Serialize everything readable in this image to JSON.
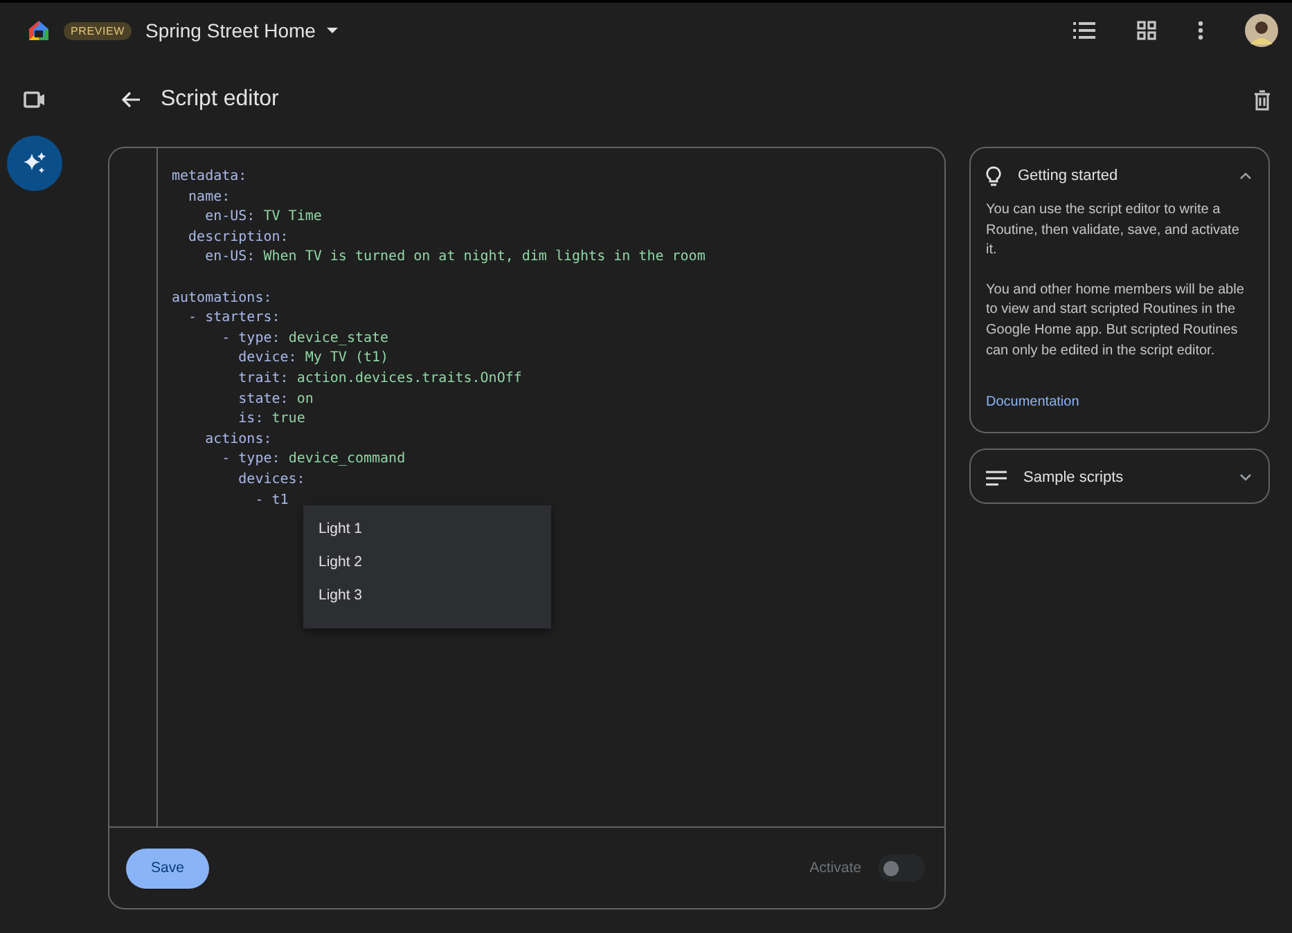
{
  "app_bar": {
    "badge": "PREVIEW",
    "home_name": "Spring Street Home"
  },
  "page": {
    "title": "Script editor"
  },
  "editor": {
    "lines": [
      {
        "kind": "code",
        "key": "metadata:"
      },
      {
        "kind": "code",
        "key": "  name:"
      },
      {
        "kind": "code",
        "key": "    en-US:",
        "value": "TV Time"
      },
      {
        "kind": "code",
        "key": "  description:"
      },
      {
        "kind": "code",
        "key": "    en-US:",
        "value": "When TV is turned on at night, dim lights in the room"
      },
      {
        "kind": "blank"
      },
      {
        "kind": "code",
        "key": "automations:"
      },
      {
        "kind": "code",
        "key": "  - starters:"
      },
      {
        "kind": "code",
        "key": "      - type:",
        "value": "device_state"
      },
      {
        "kind": "code",
        "key": "        device:",
        "value": "My TV (t1)"
      },
      {
        "kind": "code",
        "key": "        trait:",
        "value": "action.devices.traits.OnOff"
      },
      {
        "kind": "code",
        "key": "        state:",
        "value": "on"
      },
      {
        "kind": "code",
        "key": "        is:",
        "value": "true"
      },
      {
        "kind": "code",
        "key": "    actions:"
      },
      {
        "kind": "code",
        "key": "      - type:",
        "value": "device_command"
      },
      {
        "kind": "code",
        "key": "        devices:"
      },
      {
        "kind": "code",
        "key": "          - t1"
      }
    ],
    "suggestions": [
      {
        "label": "Light 1"
      },
      {
        "label": "Light 2"
      },
      {
        "label": "Light 3"
      }
    ],
    "save_label": "Save",
    "activate_label": "Activate",
    "activate_on": false
  },
  "panels": [
    {
      "title": "Getting started",
      "expanded": true,
      "paragraphs": [
        "You can use the script editor to write a Routine, then validate, save, and activate it.",
        "You and other home members will be able to view and start scripted Routines in the Google Home app. But scripted Routines can only be edited in the script editor."
      ],
      "link": "Documentation"
    },
    {
      "title": "Sample scripts",
      "expanded": false
    }
  ]
}
